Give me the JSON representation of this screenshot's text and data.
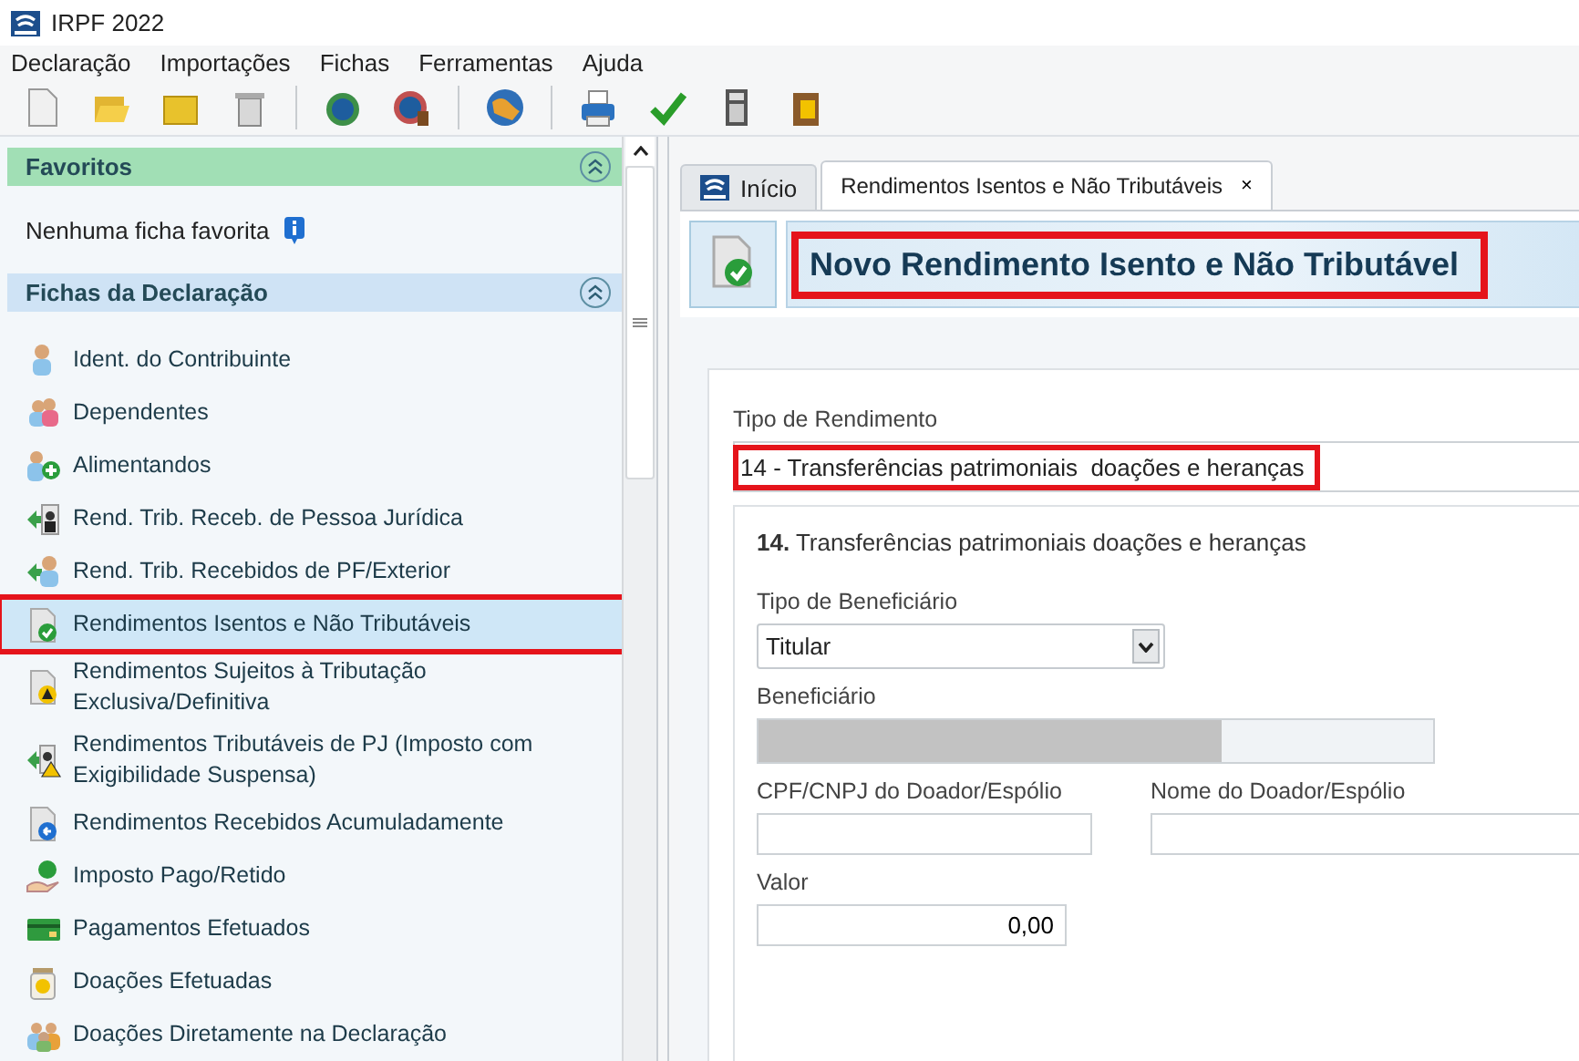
{
  "window": {
    "title": "IRPF 2022"
  },
  "menu": [
    "Declaração",
    "Importações",
    "Fichas",
    "Ferramentas",
    "Ajuda"
  ],
  "sidebar": {
    "favorites": {
      "title": "Favoritos",
      "empty_text": "Nenhuma ficha favorita"
    },
    "fichas": {
      "title": "Fichas da Declaração",
      "items": [
        {
          "label": "Ident. do Contribuinte",
          "selected": false,
          "highlighted": false
        },
        {
          "label": "Dependentes",
          "selected": false,
          "highlighted": false
        },
        {
          "label": "Alimentandos",
          "selected": false,
          "highlighted": false
        },
        {
          "label": "Rend. Trib. Receb. de Pessoa Jurídica",
          "selected": false,
          "highlighted": false
        },
        {
          "label": "Rend. Trib. Recebidos de PF/Exterior",
          "selected": false,
          "highlighted": false
        },
        {
          "label": "Rendimentos Isentos e Não Tributáveis",
          "selected": true,
          "highlighted": true
        },
        {
          "label": "Rendimentos Sujeitos à Tributação Exclusiva/Definitiva",
          "selected": false,
          "highlighted": false
        },
        {
          "label": "Rendimentos Tributáveis de PJ (Imposto com Exigibilidade Suspensa)",
          "selected": false,
          "highlighted": false
        },
        {
          "label": "Rendimentos Recebidos Acumuladamente",
          "selected": false,
          "highlighted": false
        },
        {
          "label": "Imposto Pago/Retido",
          "selected": false,
          "highlighted": false
        },
        {
          "label": "Pagamentos Efetuados",
          "selected": false,
          "highlighted": false
        },
        {
          "label": "Doações Efetuadas",
          "selected": false,
          "highlighted": false
        },
        {
          "label": "Doações Diretamente na Declaração",
          "selected": false,
          "highlighted": false
        }
      ]
    }
  },
  "tabs": [
    {
      "label": "Início",
      "selected": false,
      "closable": false
    },
    {
      "label": "Rendimentos Isentos e Não Tributáveis",
      "selected": true,
      "closable": true,
      "close": "×"
    }
  ],
  "header": {
    "title": "Novo Rendimento Isento e Não Tributável",
    "highlighted": true
  },
  "form": {
    "tipo_rendimento": {
      "label": "Tipo de Rendimento",
      "value": "14 - Transferências patrimoniais  doações e heranças",
      "highlighted": true
    },
    "section": {
      "number": "14.",
      "title": "Transferências patrimoniais doações e heranças"
    },
    "tipo_beneficiario": {
      "label": "Tipo de Beneficiário",
      "value": "Titular"
    },
    "beneficiario": {
      "label": "Beneficiário",
      "redacted": true
    },
    "cpf_doador": {
      "label": "CPF/CNPJ do Doador/Espólio"
    },
    "nome_doador": {
      "label": "Nome do Doador/Espólio"
    },
    "valor": {
      "label": "Valor",
      "value": "0,00"
    }
  }
}
